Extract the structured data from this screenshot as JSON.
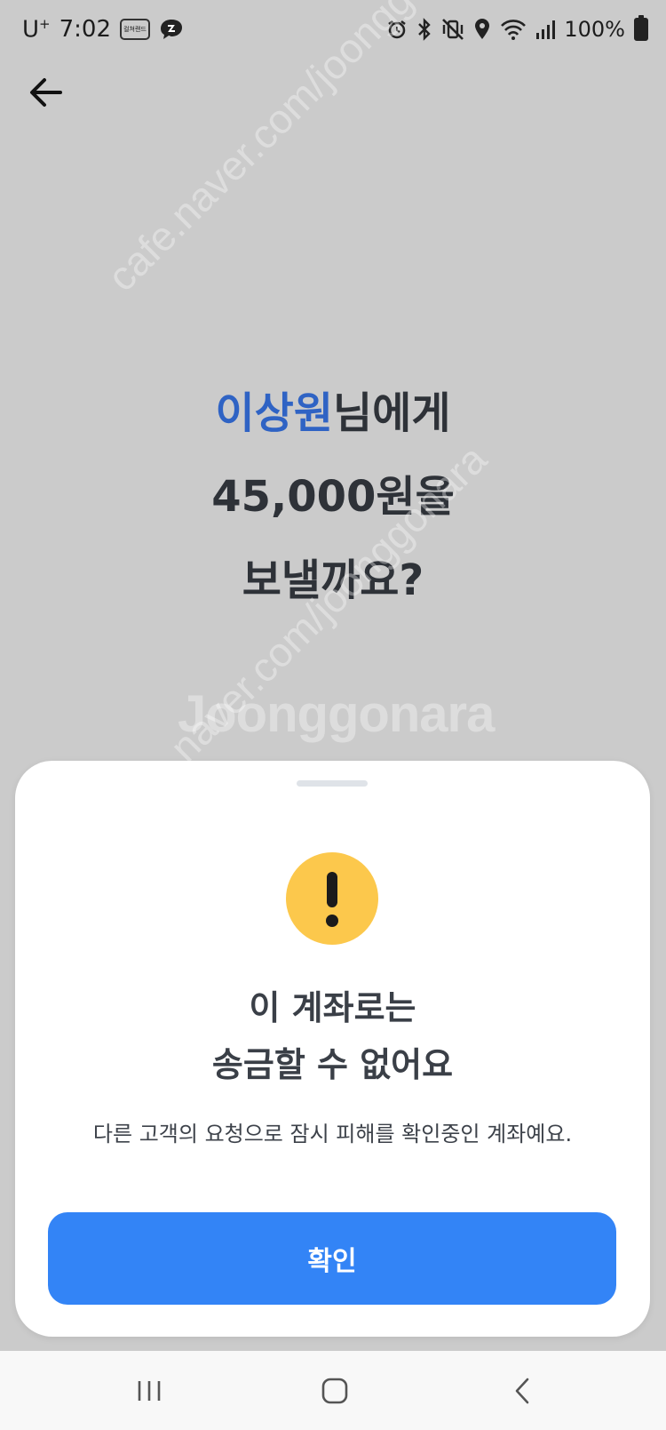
{
  "status_bar": {
    "carrier": "U",
    "carrier_sup": "+",
    "time": "7:02",
    "app_badge": "컬쳐랜드",
    "battery": "100%"
  },
  "question": {
    "recipient": "이상원",
    "recipient_suffix": "님에게",
    "amount_line": "45,000원을",
    "action_line": "보낼까요?"
  },
  "watermark": {
    "brand": "Joonggonara",
    "url": "cafe.naver.com/joonggonara"
  },
  "sheet": {
    "title_line1": "이 계좌로는",
    "title_line2": "송금할 수 없어요",
    "description": "다른 고객의 요청으로 잠시 피해를 확인중인 계좌예요.",
    "confirm_label": "확인"
  },
  "colors": {
    "recipient": "#2f63c4",
    "warning": "#fcc84c",
    "button": "#3384f6",
    "overlay": "#cbcbcb"
  },
  "icons": {
    "back": "arrow-left-icon",
    "warning": "exclamation-icon",
    "nav_recent": "recent-apps-icon",
    "nav_home": "home-icon",
    "nav_back": "chevron-left-icon"
  }
}
